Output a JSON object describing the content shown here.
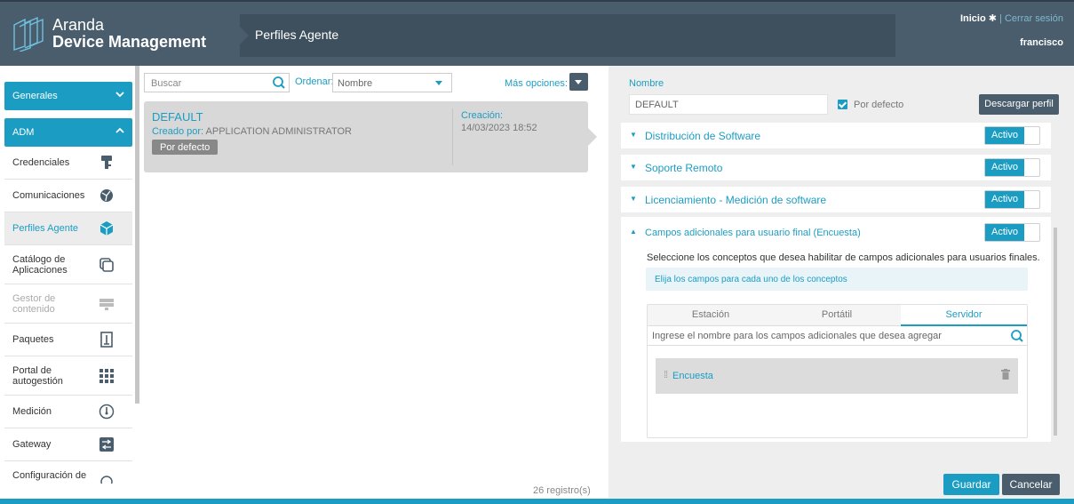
{
  "app": {
    "brand_line1": "Aranda",
    "brand_line2": "Device Management",
    "breadcrumb": "Perfiles Agente"
  },
  "header": {
    "inicio": "Inicio",
    "separator": "|",
    "logout": "Cerrar sesión",
    "user": "francisco"
  },
  "sidebar": {
    "groups": [
      {
        "label": "Generales",
        "chevron": "chevron-down-icon"
      },
      {
        "label": "ADM",
        "chevron": "chevron-up-icon"
      }
    ],
    "items": [
      {
        "label": "Credenciales",
        "icon": "key-icon"
      },
      {
        "label": "Comunicaciones",
        "icon": "network-icon"
      },
      {
        "label": "Perfiles Agente",
        "icon": "box-icon",
        "active": true
      },
      {
        "label": "Catálogo de Aplicaciones",
        "icon": "catalog-icon"
      },
      {
        "label": "Gestor de contenido",
        "icon": "server-icon",
        "disabled": true
      },
      {
        "label": "Paquetes",
        "icon": "package-icon"
      },
      {
        "label": "Portal de autogestión",
        "icon": "grid-icon"
      },
      {
        "label": "Medición",
        "icon": "gauge-icon"
      },
      {
        "label": "Gateway",
        "icon": "gateway-icon"
      },
      {
        "label": "Configuración de",
        "icon": "settings-icon"
      }
    ]
  },
  "list": {
    "search_placeholder": "Buscar",
    "order_label": "Ordenar:",
    "order_value": "Nombre",
    "more_label": "Más opciones:",
    "card": {
      "title": "DEFAULT",
      "created_by_label": "Creado por:",
      "created_by": "APPLICATION ADMINISTRATOR",
      "badge": "Por defecto",
      "creation_label": "Creación:",
      "creation_date": "14/03/2023 18:52"
    },
    "count": "26 registro(s)"
  },
  "detail": {
    "name_label": "Nombre",
    "name_value": "DEFAULT",
    "default_label": "Por defecto",
    "download_label": "Descargar perfil",
    "sections": [
      {
        "title": "Distribución de Software",
        "status": "Activo"
      },
      {
        "title": "Soporte Remoto",
        "status": "Activo"
      },
      {
        "title": "Licenciamiento - Medición de software",
        "status": "Activo"
      },
      {
        "title": "Campos adicionales para usuario final (Encuesta)",
        "status": "Activo"
      }
    ],
    "description": "Seleccione los conceptos que desea habilitar de campos adicionales para usuarios finales.",
    "info": "Elija los campos para cada uno de los conceptos",
    "tabs": [
      "Estación",
      "Portátil",
      "Servidor"
    ],
    "field_placeholder": "Ingrese el nombre para los campos adicionales que desea agregar",
    "item_label": "Encuesta",
    "save_label": "Guardar",
    "cancel_label": "Cancelar"
  },
  "colors": {
    "accent": "#1b9dc3",
    "header": "#4a5d6c",
    "panel": "#eeeeee"
  }
}
